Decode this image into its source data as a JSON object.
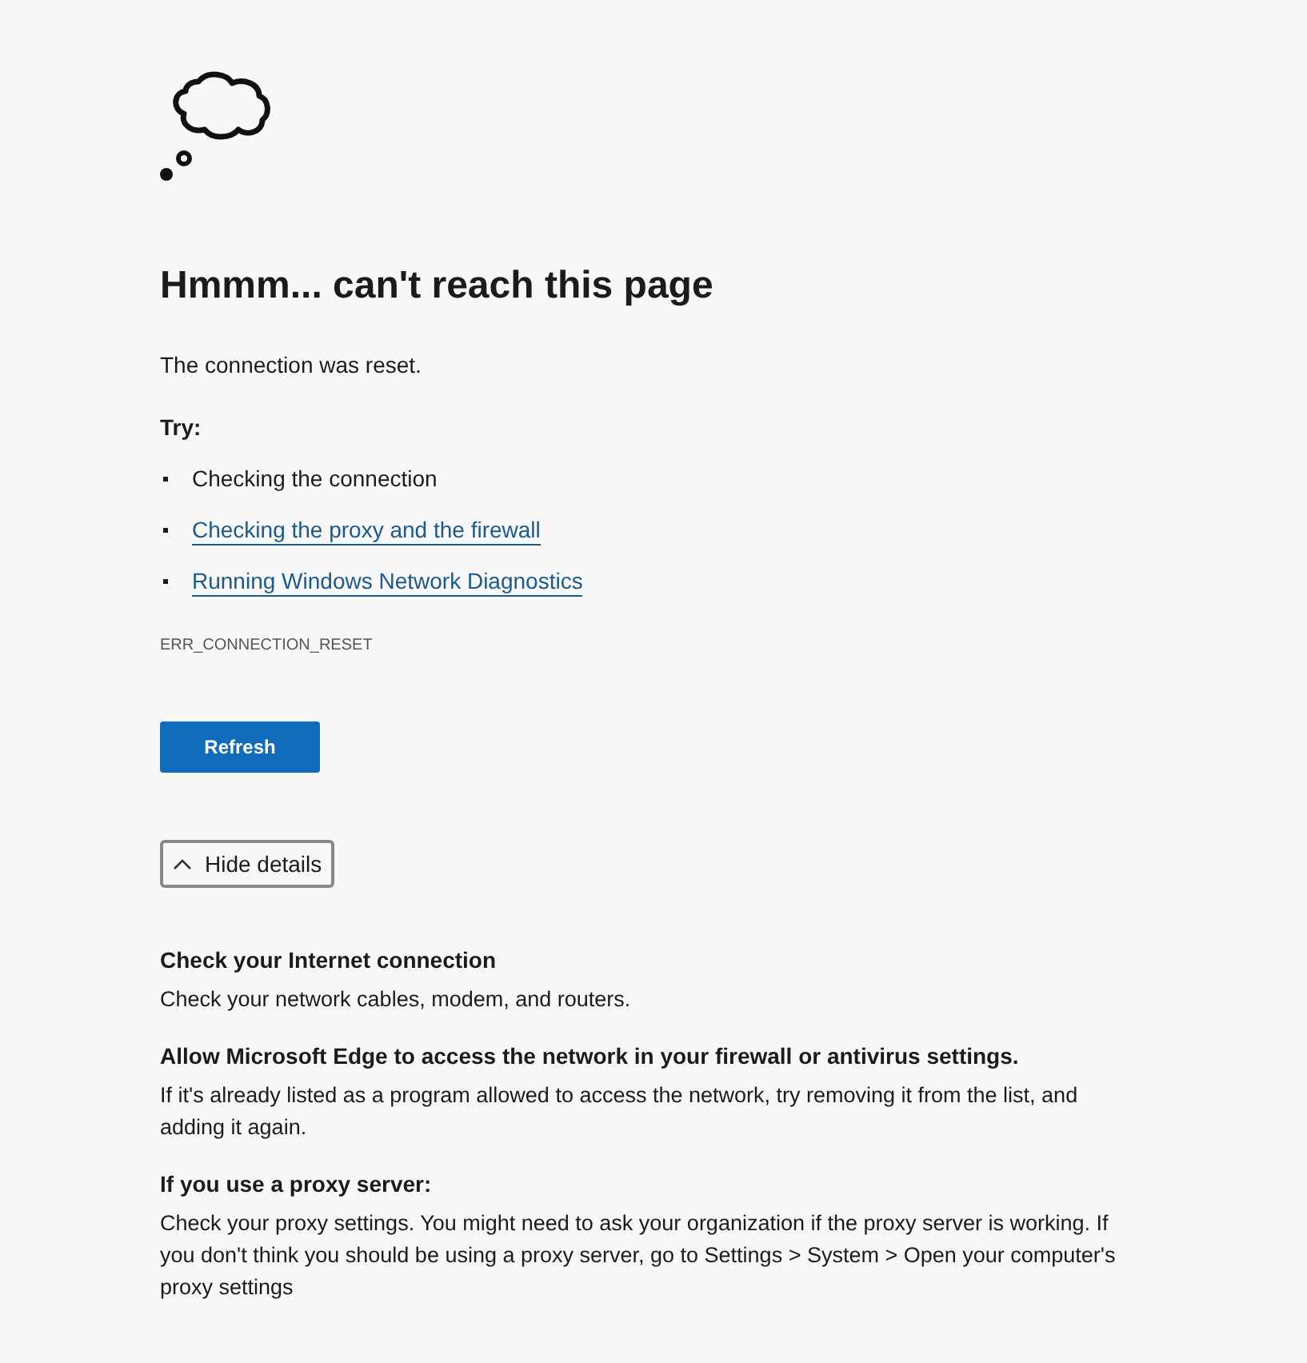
{
  "heading": "Hmmm... can't reach this page",
  "message": "The connection was reset.",
  "try_label": "Try:",
  "suggestions": [
    {
      "kind": "text",
      "label": "Checking the connection"
    },
    {
      "kind": "link",
      "label": "Checking the proxy and the firewall"
    },
    {
      "kind": "link",
      "label": "Running Windows Network Diagnostics"
    }
  ],
  "error_code": "ERR_CONNECTION_RESET",
  "refresh_button": "Refresh",
  "details_toggle": {
    "label": "Hide details",
    "expanded": true
  },
  "details": [
    {
      "title": "Check your Internet connection",
      "body": "Check your network cables, modem, and routers."
    },
    {
      "title": "Allow Microsoft Edge to access the network in your firewall or antivirus settings.",
      "body": "If it's already listed as a program allowed to access the network, try removing it from the list, and adding it again."
    },
    {
      "title": "If you use a proxy server:",
      "body": "Check your proxy settings. You might need to ask your organization if the proxy server is working. If you don't think you should be using a proxy server, go to Settings > System > Open your computer's proxy settings"
    }
  ]
}
